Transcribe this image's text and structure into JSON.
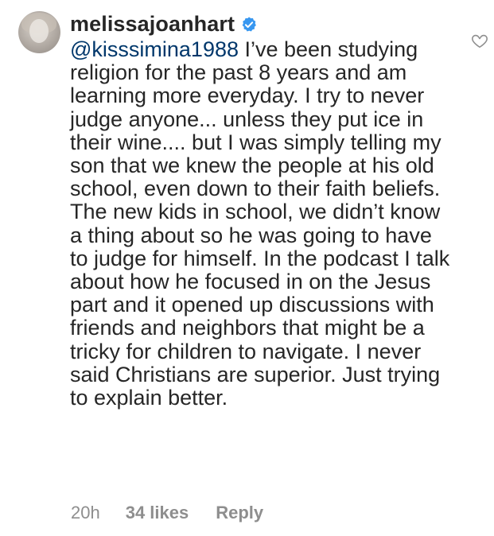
{
  "comment": {
    "username": "melissajoanhart",
    "verified": true,
    "mention": "@kisssimina1988",
    "text": " I’ve been studying religion for the past 8 years and am learning more everyday. I try to never judge anyone... unless they put ice in their wine.... but I was simply telling my son that we knew the people at his old school, even down to their faith beliefs. The new kids in school, we didn’t know a thing about so he was going to have to judge for himself. In the podcast I talk about how he focused in on the Jesus part and it opened up discussions with friends and neighbors that might be a tricky for children to navigate. I never said Christians are superior. Just trying to explain better.",
    "time": "20h",
    "likes": "34 likes",
    "reply_label": "Reply"
  },
  "icons": {
    "verified": "verified-badge-icon",
    "like": "heart-icon"
  },
  "colors": {
    "text": "#262626",
    "mention": "#00376b",
    "meta": "#8e8e8e",
    "verified": "#3897f0"
  }
}
